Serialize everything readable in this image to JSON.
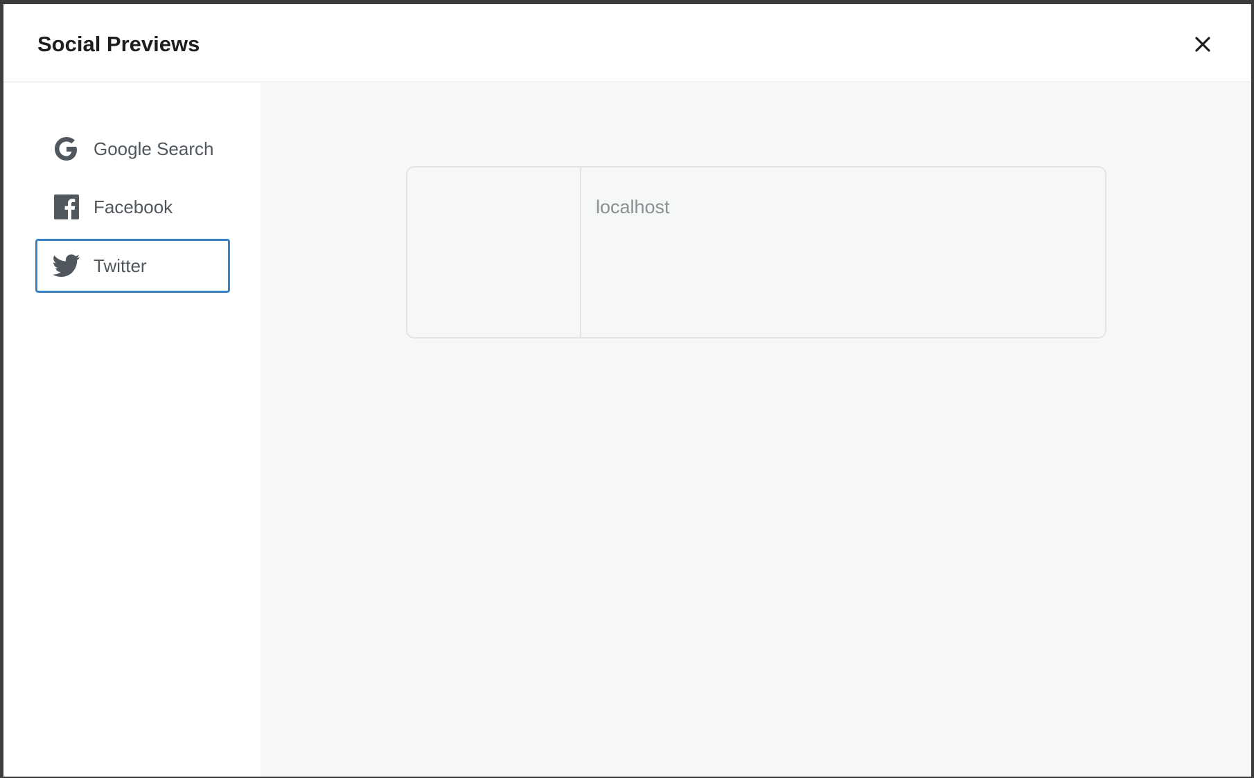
{
  "modal": {
    "title": "Social Previews",
    "close_icon": "close-icon"
  },
  "sidebar": {
    "items": [
      {
        "label": "Google Search",
        "icon": "google-icon",
        "active": false
      },
      {
        "label": "Facebook",
        "icon": "facebook-icon",
        "active": false
      },
      {
        "label": "Twitter",
        "icon": "twitter-icon",
        "active": true
      }
    ]
  },
  "preview": {
    "domain": "localhost"
  },
  "colors": {
    "accent": "#3582c4",
    "text": "#50575e",
    "title": "#1e1e1e",
    "content_bg": "#f6f7f7",
    "domain_text": "#8c8f94"
  }
}
